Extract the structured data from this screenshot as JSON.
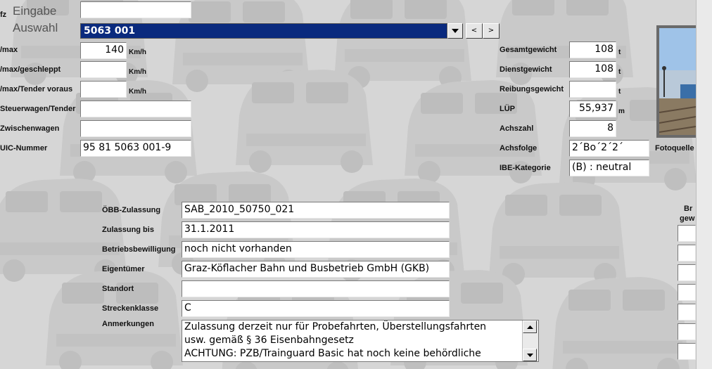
{
  "header": {
    "frag_label": "fz",
    "eingabe_label": "Eingabe",
    "eingabe_value": "",
    "auswahl_label": "Auswahl",
    "auswahl_value": "5063 001",
    "prev_label": "<",
    "next_label": ">",
    "dropdown_icon": "triangle-down"
  },
  "speeds": {
    "vmax_label": "/max",
    "vmax_value": "140",
    "vmax_unit": "Km/h",
    "geschleppt_label": "/max/geschleppt",
    "geschleppt_value": "",
    "geschleppt_unit": "Km/h",
    "tender_label": "/max/Tender voraus",
    "tender_value": "",
    "tender_unit": "Km/h"
  },
  "cars": {
    "steuerwagen_label": "Steuerwagen/Tender",
    "steuerwagen_value": "",
    "zwischenwagen_label": "Zwischenwagen",
    "zwischenwagen_value": "",
    "uic_label": "UIC-Nummer",
    "uic_value": "95 81 5063 001-9"
  },
  "specs": {
    "gesamtgewicht_label": "Gesamtgewicht",
    "gesamtgewicht_value": "108",
    "gesamtgewicht_unit": "t",
    "dienstgewicht_label": "Dienstgewicht",
    "dienstgewicht_value": "108",
    "dienstgewicht_unit": "t",
    "reibungsgewicht_label": "Reibungsgewicht",
    "reibungsgewicht_value": "",
    "reibungsgewicht_unit": "t",
    "lup_label": "LÜP",
    "lup_value": "55,937",
    "lup_unit": "m",
    "achszahl_label": "Achszahl",
    "achszahl_value": "8",
    "achsfolge_label": "Achsfolge",
    "achsfolge_value": "2´Bo´2´2´",
    "ibe_label": "IBE-Kategorie",
    "ibe_value": "(B) : neutral"
  },
  "photo": {
    "caption": "Fotoquelle"
  },
  "right_partial": {
    "line1": "Br",
    "line2": "gew"
  },
  "approval": {
    "oebb_label": "ÖBB-Zulassung",
    "oebb_value": "SAB_2010_50750_021",
    "bis_label": "Zulassung bis",
    "bis_value": "31.1.2011",
    "betrieb_label": "Betriebsbewilligung",
    "betrieb_value": "noch nicht vorhanden",
    "eigentuemer_label": "Eigentümer",
    "eigentuemer_value": "Graz-Köflacher Bahn und Busbetrieb GmbH  (GKB)",
    "standort_label": "Standort",
    "standort_value": "",
    "strecken_label": "Streckenklasse",
    "strecken_value": "C",
    "anmerkungen_label": "Anmerkungen",
    "anmerkungen_lines": [
      "Zulassung derzeit nur für Probefahrten, Überstellungsfahrten",
      "usw. gemäß § 36 Eisenbahngesetz",
      "ACHTUNG: PZB/Trainguard Basic hat noch keine behördliche"
    ]
  }
}
